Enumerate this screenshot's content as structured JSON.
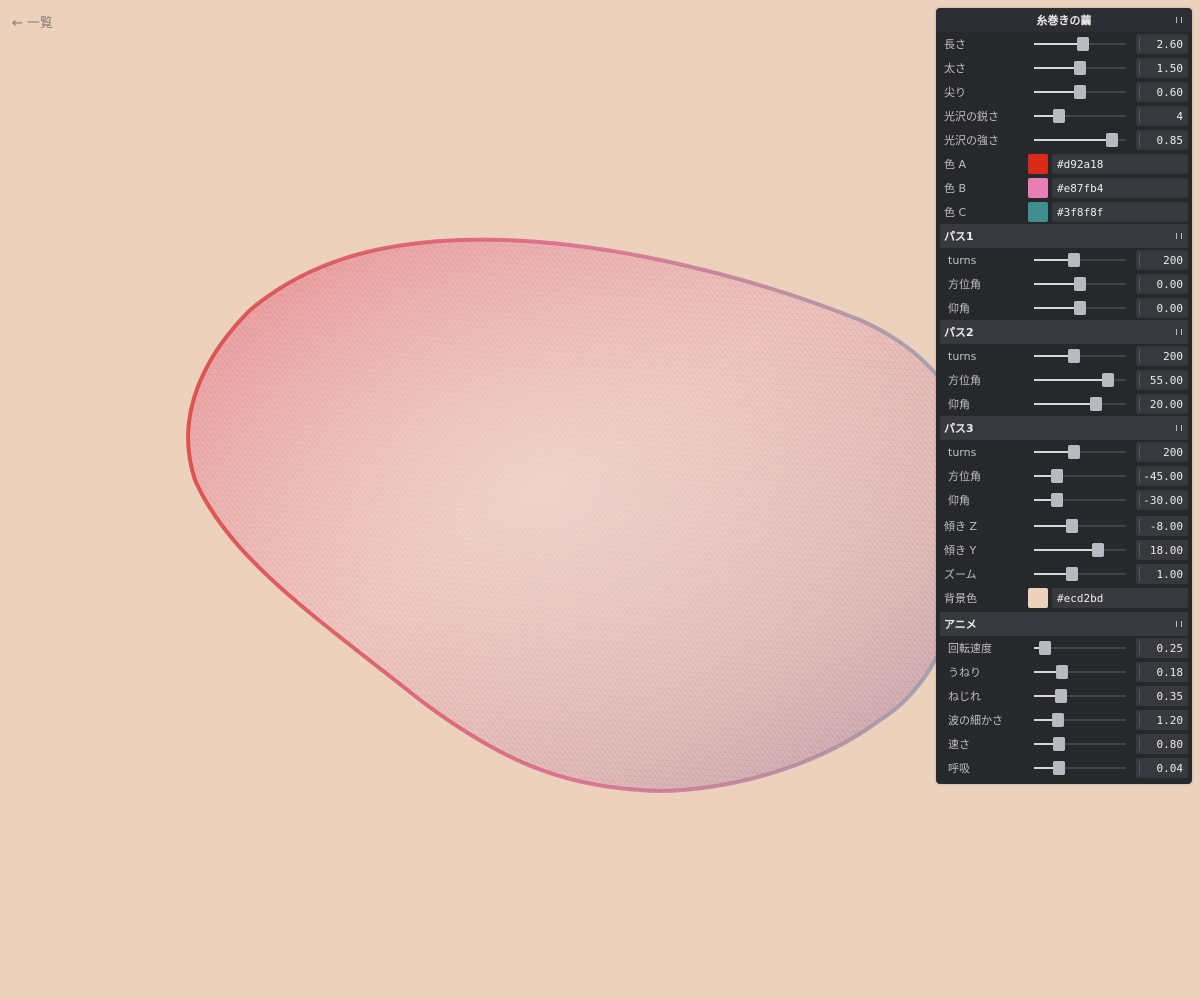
{
  "back": {
    "arrow": "←",
    "label": "一覧"
  },
  "background_color": "#ecd2bd",
  "gui": {
    "title": "糸巻きの繭",
    "main": [
      {
        "label": "長さ",
        "value": "2.60",
        "pos": 0.53
      },
      {
        "label": "太さ",
        "value": "1.50",
        "pos": 0.5
      },
      {
        "label": "尖り",
        "value": "0.60",
        "pos": 0.5
      },
      {
        "label": "光沢の鋭さ",
        "value": "4",
        "pos": 0.27
      },
      {
        "label": "光沢の強さ",
        "value": "0.85",
        "pos": 0.85
      }
    ],
    "colors": [
      {
        "label": "色 A",
        "hex": "#d92a18"
      },
      {
        "label": "色 B",
        "hex": "#e87fb4"
      },
      {
        "label": "色 C",
        "hex": "#3f8f8f"
      }
    ],
    "pass1": {
      "title": "パス1",
      "rows": [
        {
          "label": "turns",
          "value": "200",
          "pos": 0.43
        },
        {
          "label": "方位角",
          "value": "0.00",
          "pos": 0.5
        },
        {
          "label": "仰角",
          "value": "0.00",
          "pos": 0.5
        }
      ]
    },
    "pass2": {
      "title": "パス2",
      "rows": [
        {
          "label": "turns",
          "value": "200",
          "pos": 0.43
        },
        {
          "label": "方位角",
          "value": "55.00",
          "pos": 0.8
        },
        {
          "label": "仰角",
          "value": "20.00",
          "pos": 0.67
        }
      ]
    },
    "pass3": {
      "title": "パス3",
      "rows": [
        {
          "label": "turns",
          "value": "200",
          "pos": 0.43
        },
        {
          "label": "方位角",
          "value": "-45.00",
          "pos": 0.25
        },
        {
          "label": "仰角",
          "value": "-30.00",
          "pos": 0.25
        }
      ]
    },
    "tilt": [
      {
        "label": "傾き Z",
        "value": "-8.00",
        "pos": 0.41
      },
      {
        "label": "傾き Y",
        "value": "18.00",
        "pos": 0.7
      },
      {
        "label": "ズーム",
        "value": "1.00",
        "pos": 0.41
      }
    ],
    "bg": {
      "label": "背景色",
      "hex": "#ecd2bd"
    },
    "anim": {
      "title": "アニメ",
      "rows": [
        {
          "label": "回転速度",
          "value": "0.25",
          "pos": 0.12
        },
        {
          "label": "うねり",
          "value": "0.18",
          "pos": 0.3
        },
        {
          "label": "ねじれ",
          "value": "0.35",
          "pos": 0.29
        },
        {
          "label": "波の細かさ",
          "value": "1.20",
          "pos": 0.26
        },
        {
          "label": "速さ",
          "value": "0.80",
          "pos": 0.27
        },
        {
          "label": "呼吸",
          "value": "0.04",
          "pos": 0.27
        }
      ]
    }
  }
}
